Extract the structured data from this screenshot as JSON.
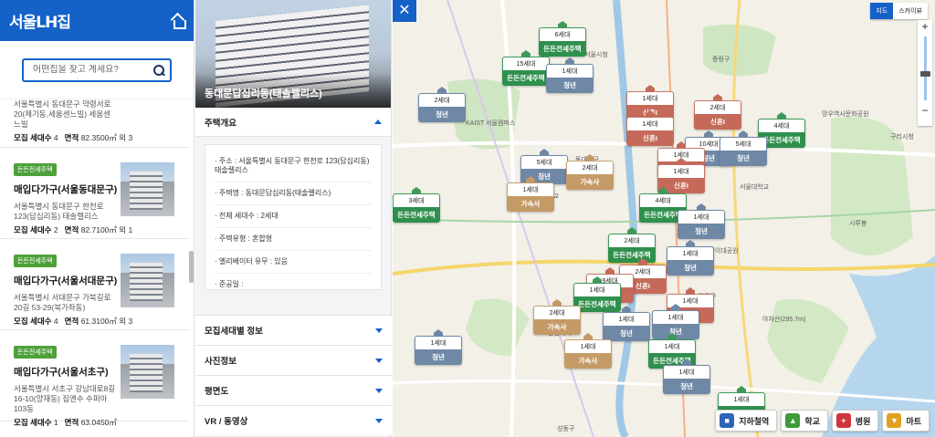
{
  "app": {
    "logo_text": "서울LH집"
  },
  "search": {
    "placeholder": "어떤집을 찾고 계세요?"
  },
  "list": {
    "partial_item": {
      "addr": "서울특별시 동대문구 약령서로 20(제기동,세움센느빌) 세움센느빌",
      "units_label": "모집 세대수",
      "units": "4",
      "area_label": "면적",
      "area": "82.3500㎡ 외 3"
    },
    "items": [
      {
        "badge": "든든전세주택",
        "title": "매입다가구(서울동대문구)",
        "addr": "서울특별시 동대문구 한천로 123(답십리동) 태솔렐리스",
        "units_label": "모집 세대수",
        "units": "2",
        "area_label": "면적",
        "area": "82.7100㎡ 외 1"
      },
      {
        "badge": "든든전세주택",
        "title": "매입다가구(서울서대문구)",
        "addr": "서울특별시 서대문구 가북길로20길 53-29(북가좌동)",
        "units_label": "모집 세대수",
        "units": "4",
        "area_label": "면적",
        "area": "61.3100㎡ 외 3"
      },
      {
        "badge": "든든전세주택",
        "title": "매입다가구(서울서초구)",
        "addr": "서울특별시 서초구 강남대로8길 16-10(양재동) 집앤수 수퍼아 103동",
        "units_label": "모집 세대수",
        "units": "1",
        "area_label": "면적",
        "area": "63.0450㎡"
      }
    ]
  },
  "detail": {
    "hero_title": "동대문답십리동(태솔렐리스)",
    "overview_header": "주택개요",
    "info": [
      "· 주소 : 서울특별시 동대문구 한천로 123(답십리동) 태솔렐리스",
      "· 주택명 : 동대문답십리동(태솔렐리스)",
      "· 전체 세대수 : 2세대",
      "· 주택유형 : 혼합형",
      "· 엘리베이터 유무 : 있음",
      "· 준공일 :"
    ],
    "accordions": [
      "모집세대별 정보",
      "사진정보",
      "평면도",
      "VR / 동영상"
    ]
  },
  "map": {
    "type_buttons": [
      "지도",
      "스카이뷰"
    ],
    "zoom_plus": "+",
    "zoom_minus": "−",
    "close": "✕",
    "poi": [
      {
        "label": "지하철역",
        "icon": "subway-icon",
        "color": "#2c64b8"
      },
      {
        "label": "학교",
        "icon": "school-icon",
        "color": "#3f9a3a"
      },
      {
        "label": "병원",
        "icon": "hospital-icon",
        "color": "#d0343c"
      },
      {
        "label": "마트",
        "icon": "cart-icon",
        "color": "#e0a020"
      }
    ],
    "markers": [
      {
        "cnt": "6세대",
        "typ": "든든전세주택",
        "c": "green"
      },
      {
        "cnt": "15세대",
        "typ": "든든전세주택",
        "c": "green"
      },
      {
        "cnt": "1세대",
        "typ": "청년",
        "c": "blue"
      },
      {
        "cnt": "2세대",
        "typ": "청년",
        "c": "blue"
      },
      {
        "cnt": "1세대",
        "typ": "신혼I",
        "c": "red"
      },
      {
        "cnt": "1세대",
        "typ": "신혼I",
        "c": "red"
      },
      {
        "cnt": "2세대",
        "typ": "신혼I",
        "c": "red"
      },
      {
        "cnt": "4세대",
        "typ": "든든전세주택",
        "c": "green"
      },
      {
        "cnt": "5세대",
        "typ": "청년",
        "c": "blue"
      },
      {
        "cnt": "10세대",
        "typ": "청년",
        "c": "blue"
      },
      {
        "cnt": "5세대",
        "typ": "청년",
        "c": "blue"
      },
      {
        "cnt": "2세대",
        "typ": "가속사",
        "c": "tan"
      },
      {
        "cnt": "1세대",
        "typ": "신혼I",
        "c": "red"
      },
      {
        "cnt": "1세대",
        "typ": "신혼I",
        "c": "red"
      },
      {
        "cnt": "4세대",
        "typ": "든든전세주택",
        "c": "green"
      },
      {
        "cnt": "1세대",
        "typ": "가속사",
        "c": "tan"
      },
      {
        "cnt": "3세대",
        "typ": "든든전세주택",
        "c": "green"
      },
      {
        "cnt": "1세대",
        "typ": "청년",
        "c": "blue"
      },
      {
        "cnt": "2세대",
        "typ": "든든전세주택",
        "c": "green"
      },
      {
        "cnt": "1세대",
        "typ": "청년",
        "c": "blue"
      },
      {
        "cnt": "2세대",
        "typ": "신혼I",
        "c": "red"
      },
      {
        "cnt": "9세대",
        "typ": "신혼I",
        "c": "red"
      },
      {
        "cnt": "1세대",
        "typ": "든든전세주택",
        "c": "green"
      },
      {
        "cnt": "2세대",
        "typ": "가속사",
        "c": "tan"
      },
      {
        "cnt": "1세대",
        "typ": "청년",
        "c": "blue"
      },
      {
        "cnt": "1세대",
        "typ": "신혼I",
        "c": "red"
      },
      {
        "cnt": "1세대",
        "typ": "청년",
        "c": "blue"
      },
      {
        "cnt": "1세대",
        "typ": "든든전세주택",
        "c": "green"
      },
      {
        "cnt": "1세대",
        "typ": "청년",
        "c": "blue"
      },
      {
        "cnt": "1세대",
        "typ": "가속사",
        "c": "tan"
      },
      {
        "cnt": "1세대",
        "typ": "청년",
        "c": "blue"
      },
      {
        "cnt": "1세대",
        "typ": "든든전세주택",
        "c": "green"
      }
    ],
    "place_labels": [
      "서울시청",
      "KAIST 서울캠퍼스",
      "중랑구",
      "동대문구",
      "서울대학교",
      "구리시청",
      "고려대학교",
      "한양대학교",
      "아차산(295.7m)",
      "광진구",
      "성동구",
      "어린이대공원",
      "망우역사문화공원",
      "시루봉"
    ]
  }
}
